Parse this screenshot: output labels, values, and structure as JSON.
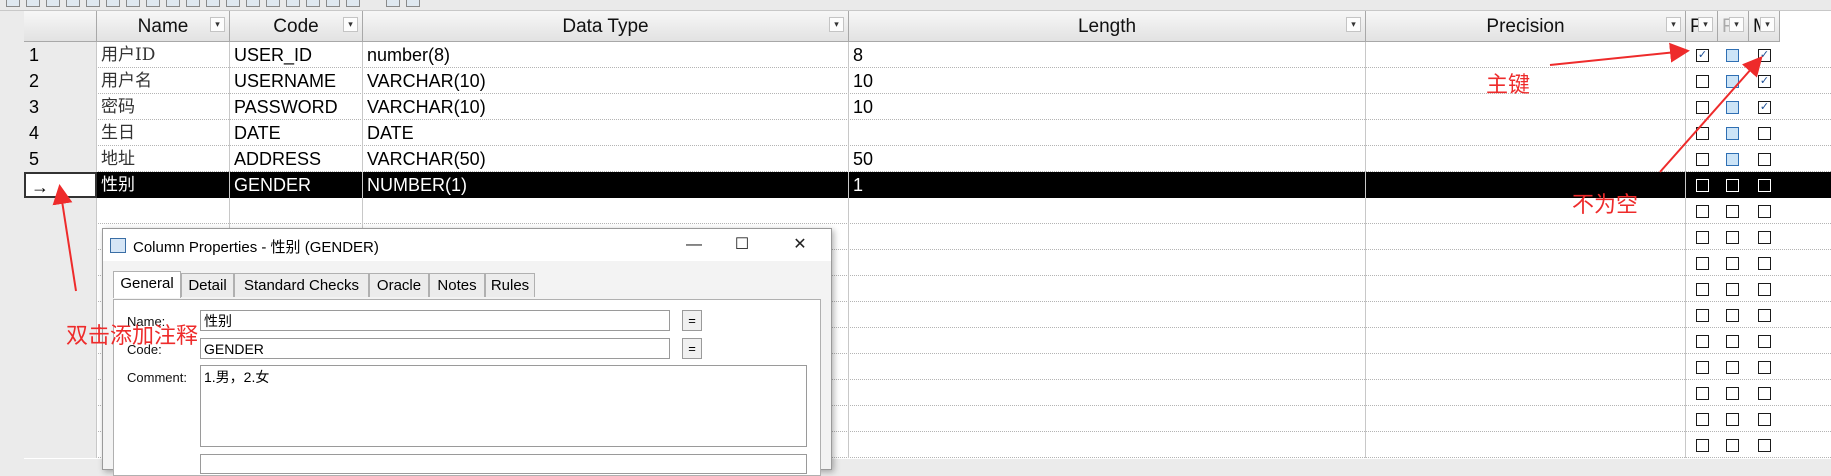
{
  "app": {
    "icon_names": [
      "toolbar-icon"
    ]
  },
  "columns": [
    {
      "label": "Name"
    },
    {
      "label": "Code"
    },
    {
      "label": "Data Type"
    },
    {
      "label": "Length"
    },
    {
      "label": "Precision"
    },
    {
      "label": "P"
    },
    {
      "label": "F"
    },
    {
      "label": "M"
    }
  ],
  "rows": [
    {
      "num": "1",
      "name": "用户ID",
      "code": "USER_ID",
      "type": "number(8)",
      "length": "8",
      "precision": "",
      "p": true,
      "f": false,
      "m": true
    },
    {
      "num": "2",
      "name": "用户名",
      "code": "USERNAME",
      "type": "VARCHAR(10)",
      "length": "10",
      "precision": "",
      "p": false,
      "f": false,
      "m": true
    },
    {
      "num": "3",
      "name": "密码",
      "code": "PASSWORD",
      "type": "VARCHAR(10)",
      "length": "10",
      "precision": "",
      "p": false,
      "f": false,
      "m": true
    },
    {
      "num": "4",
      "name": "生日",
      "code": "DATE",
      "type": "DATE",
      "length": "",
      "precision": "",
      "p": false,
      "f": false,
      "m": false
    },
    {
      "num": "5",
      "name": "地址",
      "code": "ADDRESS",
      "type": "VARCHAR(50)",
      "length": "50",
      "precision": "",
      "p": false,
      "f": false,
      "m": false
    },
    {
      "num": "→",
      "name": "性别",
      "code": "GENDER",
      "type": "NUMBER(1)",
      "length": "1",
      "precision": "",
      "p": false,
      "f": false,
      "m": false
    }
  ],
  "annotations": {
    "primary_key": "主键",
    "not_null": "不为空",
    "double_click": "双击添加注释"
  },
  "dialog": {
    "title": "Column Properties - 性别 (GENDER)",
    "tabs": [
      "General",
      "Detail",
      "Standard Checks",
      "Oracle",
      "Notes",
      "Rules"
    ],
    "active_tab": "General",
    "fields": {
      "name_label": "Name:",
      "name_value": "性别",
      "code_label": "Code:",
      "code_value": "GENDER",
      "comment_label": "Comment:",
      "comment_value": "1.男，2.女"
    },
    "minimize": "—",
    "maximize": "☐",
    "close": "✕"
  },
  "colors": {
    "annotation": "#ee2b2b",
    "selected_row": "#000000"
  }
}
